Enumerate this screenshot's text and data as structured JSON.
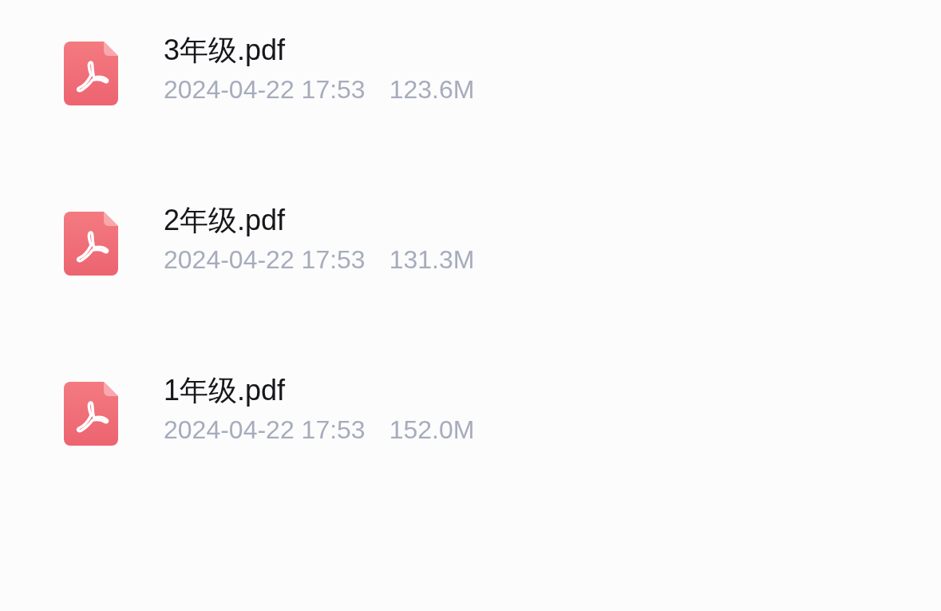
{
  "files": [
    {
      "name": "3年级.pdf",
      "date": "2024-04-22 17:53",
      "size": "123.6M"
    },
    {
      "name": "2年级.pdf",
      "date": "2024-04-22 17:53",
      "size": "131.3M"
    },
    {
      "name": "1年级.pdf",
      "date": "2024-04-22 17:53",
      "size": "152.0M"
    }
  ]
}
